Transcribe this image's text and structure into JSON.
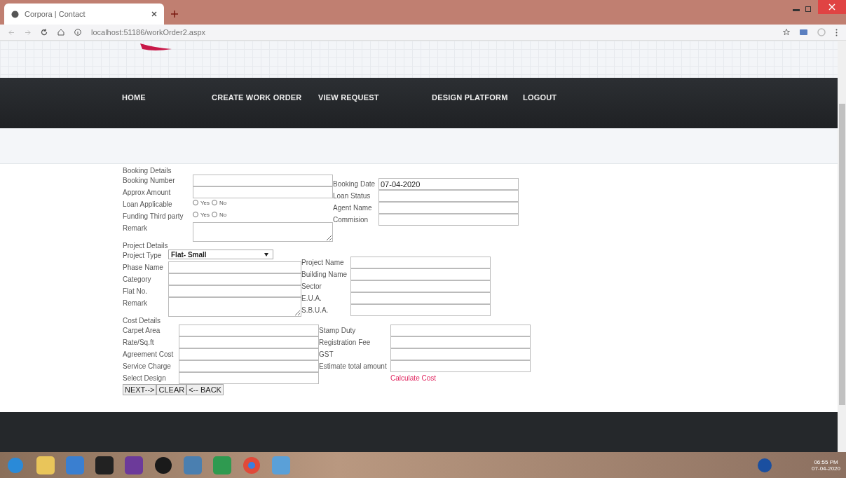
{
  "browser": {
    "tab_title": "Corpora | Contact",
    "url": "localhost:51186/workOrder2.aspx"
  },
  "nav": {
    "items": [
      {
        "label": "HOME"
      },
      {
        "label": "CREATE WORK ORDER"
      },
      {
        "label": "VIEW REQUEST"
      },
      {
        "label": "DESIGN PLATFORM"
      },
      {
        "label": "LOGOUT"
      }
    ]
  },
  "booking": {
    "title": "Booking Details",
    "left": [
      {
        "kind": "text",
        "label": "Booking Number"
      },
      {
        "kind": "text",
        "label": "Approx Amount"
      },
      {
        "kind": "radio",
        "label": "Loan Applicable",
        "options": [
          {
            "label": "Yes",
            "selected": false
          },
          {
            "label": "No",
            "selected": false
          }
        ]
      },
      {
        "kind": "radio",
        "label": "Funding Third party",
        "options": [
          {
            "label": "Yes",
            "selected": false
          },
          {
            "label": "No",
            "selected": false
          }
        ]
      },
      {
        "kind": "textarea",
        "label": "Remark"
      }
    ],
    "right": [
      {
        "kind": "text",
        "label": "Booking Date",
        "value": "07-04-2020"
      },
      {
        "kind": "text",
        "label": "Loan Status"
      },
      {
        "kind": "text",
        "label": "Agent Name"
      },
      {
        "kind": "text",
        "label": "Commision"
      }
    ]
  },
  "project": {
    "title": "Project Details",
    "left": [
      {
        "kind": "select",
        "label": "Project Type",
        "value": "Flat- Small"
      },
      {
        "kind": "text",
        "label": "Phase Name"
      },
      {
        "kind": "text",
        "label": "Category"
      },
      {
        "kind": "text",
        "label": "Flat No."
      },
      {
        "kind": "textarea",
        "label": "Remark"
      }
    ],
    "right": [
      {
        "kind": "text",
        "label": "Project Name"
      },
      {
        "kind": "text",
        "label": "Building Name"
      },
      {
        "kind": "text",
        "label": "Sector"
      },
      {
        "kind": "text",
        "label": "E.U.A."
      },
      {
        "kind": "text",
        "label": "S.B.U.A."
      }
    ]
  },
  "cost": {
    "title": "Cost Details",
    "left": [
      {
        "kind": "text",
        "label": "Carpet Area"
      },
      {
        "kind": "text",
        "label": "Rate/Sq.ft"
      },
      {
        "kind": "text",
        "label": "Agreement Cost"
      },
      {
        "kind": "text",
        "label": "Service Charge"
      },
      {
        "kind": "text",
        "label": "Select Design"
      }
    ],
    "right": [
      {
        "kind": "text",
        "label": "Stamp Duty"
      },
      {
        "kind": "text",
        "label": "Registration Fee"
      },
      {
        "kind": "text",
        "label": "GST"
      },
      {
        "kind": "text",
        "label": "Estimate total amount"
      },
      {
        "kind": "link",
        "label": "Calculate Cost"
      }
    ]
  },
  "buttons": [
    {
      "label": "NEXT-->"
    },
    {
      "label": "CLEAR"
    },
    {
      "label": "<-- BACK"
    }
  ],
  "taskbar": {
    "time": "06:55 PM",
    "date": "07-04-2020"
  }
}
